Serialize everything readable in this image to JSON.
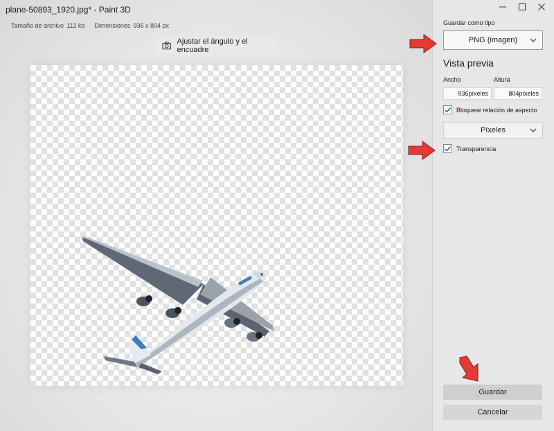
{
  "window": {
    "title": "plane-50893_1920.jpg* - Paint 3D",
    "controls": [
      "minimize-icon",
      "maximize-icon",
      "close-icon"
    ]
  },
  "file_info": {
    "size_label": "Tamaño de archivo",
    "size_value": "112 kb",
    "dims_label": "Dimensiones",
    "dims_value": "936 x 804 px"
  },
  "toolbar": {
    "crop_label": "Ajustar el ángulo y el encuadre",
    "crop_icon": "camera-icon"
  },
  "panel": {
    "save_type_label": "Guardar como tipo",
    "save_type_value": "PNG (imagen)",
    "preview_heading": "Vista previa",
    "width_label": "Ancho",
    "height_label": "Altura",
    "width_value": "936píxeles",
    "height_value": "804píxeles",
    "lock_aspect_label": "Bloquear relación de aspecto",
    "lock_aspect_checked": true,
    "unit_value": "Píxeles",
    "transparency_label": "Transparencia",
    "transparency_checked": true,
    "save_button": "Guardar",
    "cancel_button": "Cancelar"
  },
  "colors": {
    "annotation_arrow": "#e53935",
    "accent": "#0063b1"
  }
}
